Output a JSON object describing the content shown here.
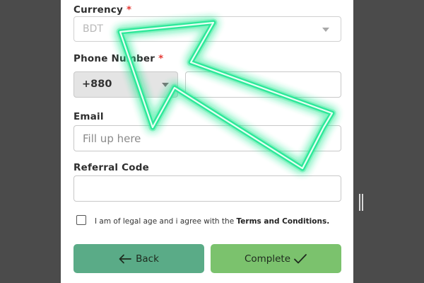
{
  "form": {
    "currency": {
      "label": "Currency",
      "required_mark": "*",
      "value": "BDT"
    },
    "phone": {
      "label": "Phone Number",
      "required_mark": "*",
      "country_code": "+880",
      "value": ""
    },
    "email": {
      "label": "Email",
      "placeholder": "Fill up here"
    },
    "referral": {
      "label": "Referral Code",
      "value": ""
    },
    "agreement": {
      "prefix": "I am of legal age and i agree with the ",
      "link": "Terms and Conditions."
    },
    "buttons": {
      "back": "Back",
      "complete": "Complete"
    }
  },
  "icons": {
    "back": "arrow-left-icon",
    "complete": "checkmark-icon",
    "overlay": "pointer-arrow-icon"
  },
  "colors": {
    "panel": "#ffffff",
    "background": "#4b4b4b",
    "back_button": "#5aab87",
    "complete_button": "#7bc26d",
    "required": "#e53935",
    "arrow_glow": "#20e890"
  }
}
